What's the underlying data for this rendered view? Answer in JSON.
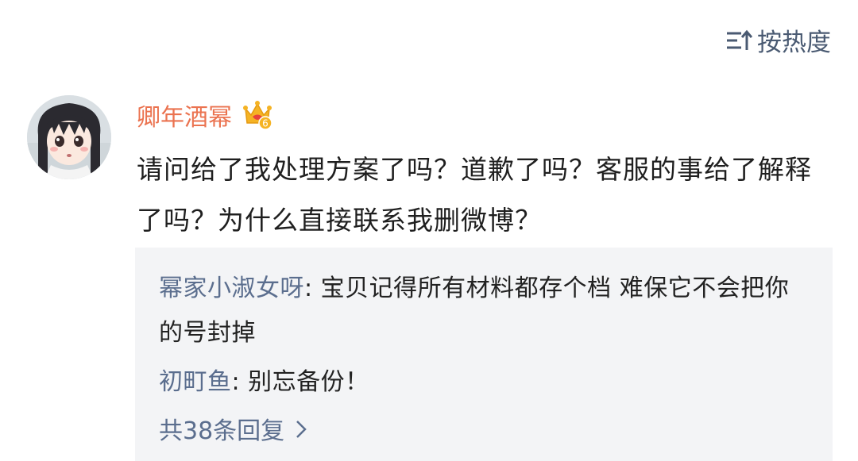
{
  "header": {
    "sort_label": "按热度",
    "sort_icon": "sort-lines-up-icon"
  },
  "comment": {
    "username": "卿年酒幂",
    "badge_icon": "crown-level-badge-icon",
    "badge_level": "6",
    "text": "请问给了我处理方案了吗？道歉了吗？客服的事给了解释了吗？为什么直接联系我删微博？"
  },
  "replies": [
    {
      "author": "幂家小淑女呀",
      "separator": ": ",
      "text": "宝贝记得所有材料都存个档 难保它不会把你的号封掉"
    },
    {
      "author": "初町鱼",
      "separator": ": ",
      "text": "别忘备份！"
    }
  ],
  "more_replies_label": "共38条回复",
  "colors": {
    "username": "#eb7350",
    "link": "#5b6e8e",
    "reply_bg": "#f3f4f6",
    "sort": "#4a5a72"
  }
}
